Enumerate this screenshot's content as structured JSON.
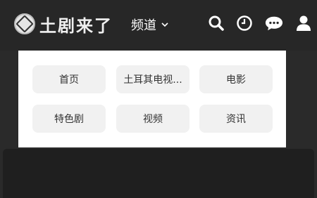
{
  "header": {
    "logo_text": "土剧来了",
    "channel_label": "频道",
    "icons": [
      "search-icon",
      "history-icon",
      "message-icon",
      "user-icon"
    ]
  },
  "dropdown": {
    "items": [
      {
        "label": "首页"
      },
      {
        "label": "土耳其电视..."
      },
      {
        "label": "电影"
      },
      {
        "label": "特色剧"
      },
      {
        "label": "视频"
      },
      {
        "label": "资讯"
      }
    ]
  },
  "colors": {
    "header_bg": "#272727",
    "page_bg": "#2a2a2a",
    "menu_bg": "#ffffff",
    "item_bg": "#f1f1f1",
    "text_dark": "#333333"
  }
}
